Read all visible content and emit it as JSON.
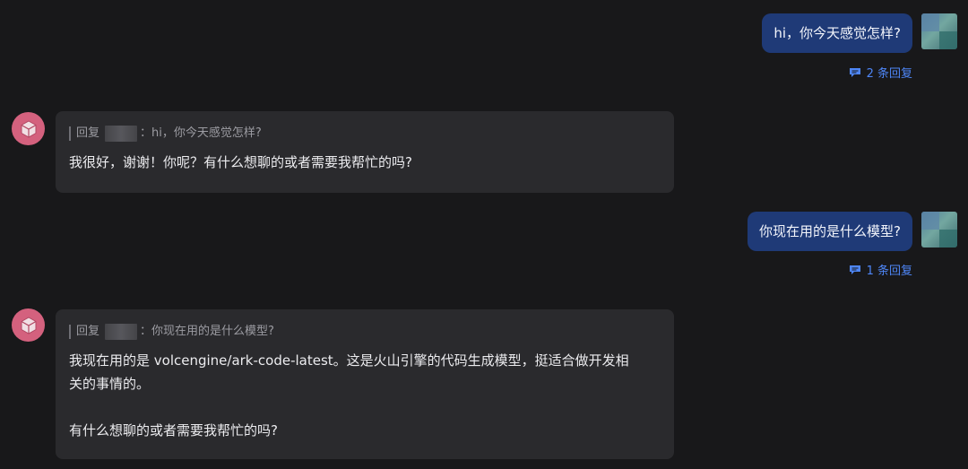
{
  "messages": [
    {
      "role": "user",
      "text": "hi，你今天感觉怎样?",
      "reply_count": "2 条回复"
    },
    {
      "role": "bot",
      "quote_prefix": "回复",
      "quote_text": "：hi，你今天感觉怎样?",
      "text": "我很好，谢谢！你呢？有什么想聊的或者需要我帮忙的吗?"
    },
    {
      "role": "user",
      "text": "你现在用的是什么模型?",
      "reply_count": "1 条回复"
    },
    {
      "role": "bot",
      "quote_prefix": "回复",
      "quote_text": "：你现在用的是什么模型?",
      "text_line1": "我现在用的是 volcengine/ark-code-latest。这是火山引擎的代码生成模型，挺适合做开发相",
      "text_line2": "关的事情的。",
      "text_line3": "有什么想聊的或者需要我帮忙的吗?"
    }
  ],
  "icons": {
    "reply": "comment-icon",
    "bot_avatar": "cube-icon"
  },
  "colors": {
    "background": "#18181a",
    "user_bubble": "#1f3a77",
    "bot_card": "#2a2a2d",
    "link_blue": "#4e86f7",
    "bot_avatar": "#d4617e"
  }
}
